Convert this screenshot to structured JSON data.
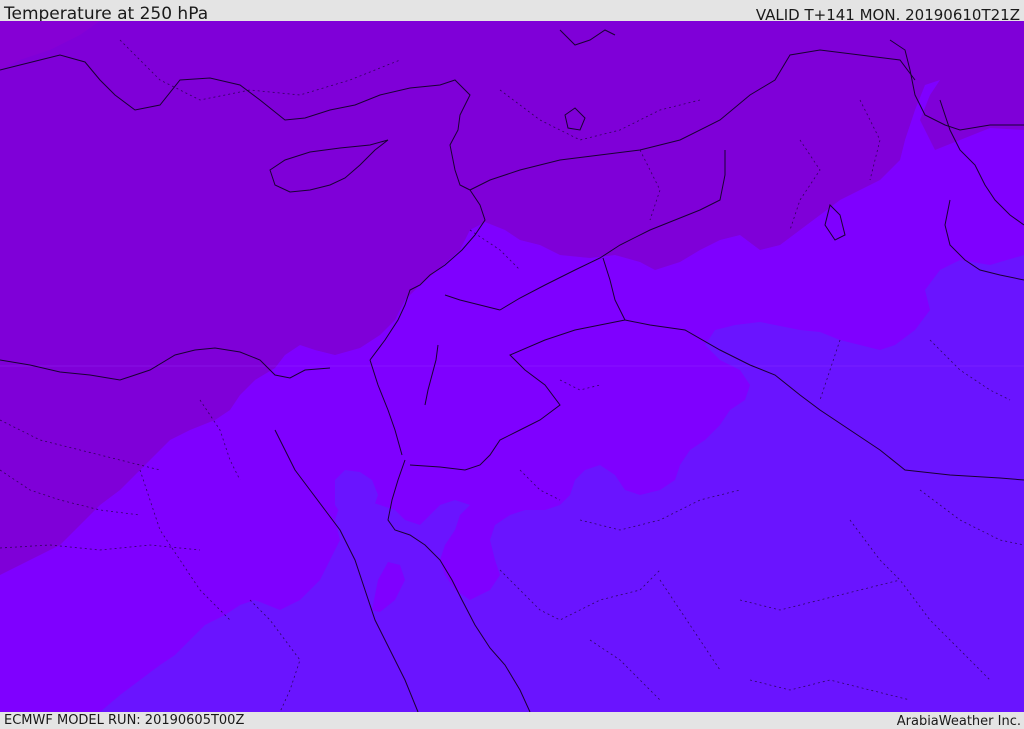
{
  "header": {
    "title": "Temperature at 250 hPa",
    "valid_time": "VALID T+141 MON. 20190610T21Z"
  },
  "footer": {
    "model_run": "ECMWF MODEL RUN: 20190605T00Z",
    "credit": "ArabiaWeather Inc."
  },
  "map": {
    "colors": {
      "coldest_band": "#7f00d8",
      "mid_band": "#7f00ff",
      "warm_band": "#6510ff",
      "warmest_band": "#6a1aff",
      "coastline": "#1a0033"
    }
  }
}
